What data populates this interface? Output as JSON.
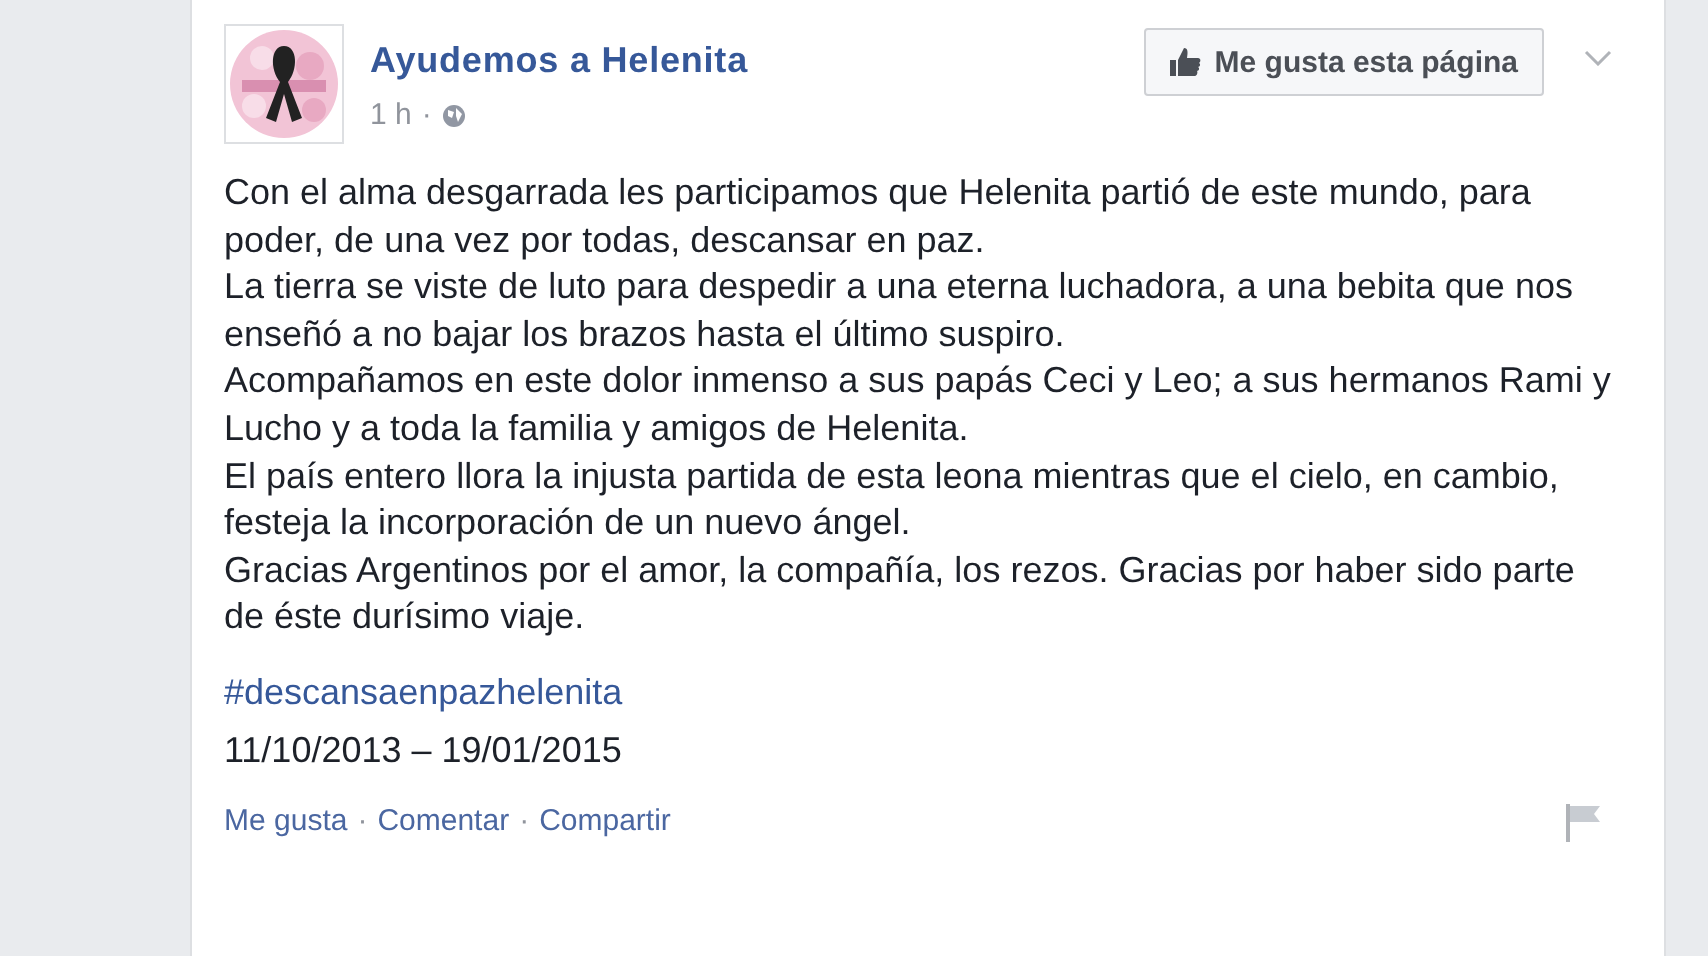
{
  "post": {
    "author": "Ayudemos a Helenita",
    "time": "1 h",
    "separator": "·",
    "like_page_button": "Me gusta esta página",
    "paragraphs": [
      "Con el alma desgarrada les participamos que Helenita partió de este mundo, para poder, de una vez por todas, descansar en paz.",
      "La tierra se viste de luto para despedir a una eterna luchadora, a una bebita que nos enseñó a no bajar los brazos hasta el último suspiro.",
      "Acompañamos en este dolor inmenso a sus papás Ceci y Leo; a sus hermanos Rami y Lucho y a toda la familia y amigos de Helenita.",
      "El país entero llora la injusta partida de esta leona mientras que el cielo, en cambio, festeja la incorporación de un nuevo ángel.",
      "Gracias Argentinos por el amor, la compañía, los rezos. Gracias por haber sido parte de éste durísimo viaje."
    ],
    "hashtag": "#descansaenpazhelenita",
    "dates": "11/10/2013 – 19/01/2015",
    "actions": [
      {
        "label": "Me gusta"
      },
      {
        "label": "Comentar"
      },
      {
        "label": "Compartir"
      }
    ]
  }
}
